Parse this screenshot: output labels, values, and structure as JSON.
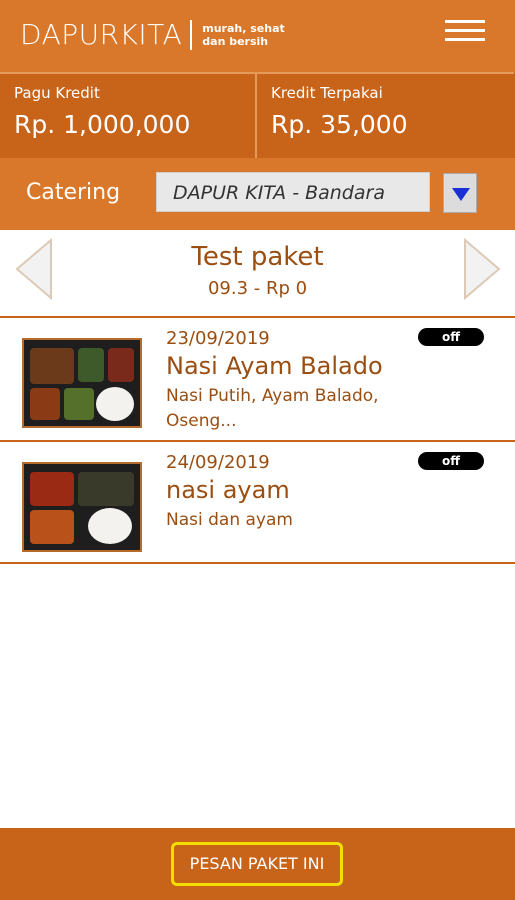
{
  "header": {
    "logo": "DAPURKITA",
    "tagline_line1": "murah, sehat",
    "tagline_line2": "dan bersih",
    "menu_icon": "hamburger-menu-icon"
  },
  "credits": {
    "limit_label": "Pagu Kredit",
    "limit_value": "Rp. 1,000,000",
    "used_label": "Kredit Terpakai",
    "used_value": "Rp. 35,000"
  },
  "catering": {
    "label": "Catering",
    "selected": "DAPUR KITA - Bandara",
    "dropdown_icon": "triangle-down-icon"
  },
  "package": {
    "title": "Test paket",
    "subtitle": "09.3 - Rp 0",
    "prev_icon": "chevron-left-icon",
    "next_icon": "chevron-right-icon"
  },
  "menu_items": [
    {
      "date": "23/09/2019",
      "name": "Nasi Ayam Balado",
      "desc": "Nasi Putih, Ayam Balado, Oseng...",
      "status": "off"
    },
    {
      "date": "24/09/2019",
      "name": "nasi ayam",
      "desc": "Nasi dan ayam",
      "status": "off"
    }
  ],
  "footer": {
    "order_button": "PESAN PAKET INI"
  },
  "colors": {
    "primary": "#d9782a",
    "dark": "#c8641a",
    "text_brown": "#9a4e12",
    "highlight": "#f4e000"
  }
}
